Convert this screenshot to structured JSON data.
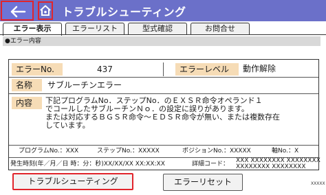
{
  "header": {
    "title": "トラブルシューティング",
    "back_icon": "back-arrow-icon",
    "home_icon": "home-icon",
    "accent_color": "#6b70c9",
    "highlight_color": "#e1242b"
  },
  "tabs": [
    {
      "label": "エラー表示",
      "active": true
    },
    {
      "label": "エラーリスト",
      "active": false
    },
    {
      "label": "型式確認",
      "active": false
    },
    {
      "label": "お問合せ",
      "active": false
    }
  ],
  "section": {
    "title": "●エラー内容"
  },
  "error": {
    "no_label": "エラーNo.",
    "no_value": "437",
    "level_label": "エラーレベル",
    "level_value": "動作解除",
    "name_label": "名称",
    "name_value": "サブルーチンエラー",
    "detail_label": "内容",
    "detail_lines": [
      "下記プログラムNo．ステップNo．のＥＸＳＲ命令オペランド１",
      "でコールしたサブルーチンＮｏ．の設定に誤りがあります。",
      "または対応するＢＧＳＲ命令〜ＥＤＳＲ命令が無い、または複数存在",
      "しています。"
    ]
  },
  "info": {
    "program": "プログラムNo.：XXX",
    "step": "ステップNo.：XXXXX",
    "position": "ポジションNo.：XXXXX",
    "axis": "軸No.：X",
    "occurred": "発生時刻(年／月／日 時：分：秒)XX/XX/XX XX:XX:XX",
    "detail_code_label": "詳細コード：",
    "detail_code_line1": "XXX XXXXXXXX XXXXXXXX",
    "detail_code_line2": "XXXXXXXX XXXXXXXX"
  },
  "buttons": {
    "troubleshoot": "トラブルシューティング",
    "reset": "エラーリセット"
  },
  "build_code": "XXXXX"
}
